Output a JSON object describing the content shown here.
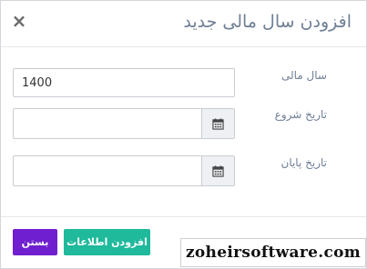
{
  "dialog": {
    "title": "افزودن سال مالی جدید",
    "close_symbol": "×"
  },
  "form": {
    "fiscal_year": {
      "label": "سال مالی",
      "value": "1400"
    },
    "start_date": {
      "label": "تاریخ شروع",
      "value": "",
      "icon": "calendar-icon"
    },
    "end_date": {
      "label": "تاریخ پایان",
      "value": "",
      "icon": "calendar-icon"
    }
  },
  "footer": {
    "add_label": "افزودن اطلاعات",
    "close_label": "بستن",
    "add_color": "#1fb99c",
    "close_color": "#6f1fcf"
  },
  "watermark": {
    "text": "zoheirsoftware.com"
  }
}
